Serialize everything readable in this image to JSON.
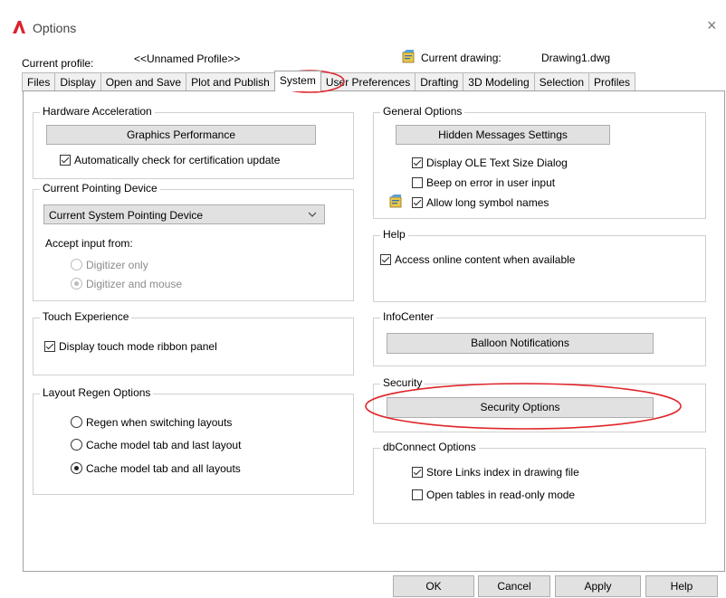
{
  "window": {
    "title": "Options",
    "close_glyph": "×"
  },
  "profile": {
    "current_profile_label": "Current profile:",
    "current_profile_value": "<<Unnamed Profile>>",
    "current_drawing_label": "Current drawing:",
    "current_drawing_value": "Drawing1.dwg"
  },
  "tabs": [
    {
      "label": "Files"
    },
    {
      "label": "Display"
    },
    {
      "label": "Open and Save"
    },
    {
      "label": "Plot and Publish"
    },
    {
      "label": "System",
      "active": true
    },
    {
      "label": "User Preferences"
    },
    {
      "label": "Drafting"
    },
    {
      "label": "3D Modeling"
    },
    {
      "label": "Selection"
    },
    {
      "label": "Profiles"
    }
  ],
  "hardware_acceleration": {
    "title": "Hardware Acceleration",
    "button": "Graphics Performance",
    "auto_check_label": "Automatically check for certification update",
    "auto_check": true
  },
  "pointing_device": {
    "title": "Current Pointing Device",
    "selected": "Current System Pointing Device",
    "accept_input_label": "Accept input from:",
    "options": [
      {
        "label": "Digitizer only",
        "selected": false
      },
      {
        "label": "Digitizer and mouse",
        "selected": true
      }
    ]
  },
  "touch_experience": {
    "title": "Touch Experience",
    "ribbon_label": "Display touch mode ribbon panel",
    "ribbon": true
  },
  "layout_regen": {
    "title": "Layout Regen Options",
    "options": [
      {
        "label": "Regen when switching layouts",
        "selected": false
      },
      {
        "label": "Cache model tab and last layout",
        "selected": false
      },
      {
        "label": "Cache model tab and all layouts",
        "selected": true
      }
    ]
  },
  "general_options": {
    "title": "General Options",
    "button": "Hidden Messages Settings",
    "items": [
      {
        "label": "Display OLE Text Size Dialog",
        "checked": true
      },
      {
        "label": "Beep on error in user input",
        "checked": false
      },
      {
        "label": "Allow long symbol names",
        "checked": true
      }
    ]
  },
  "help": {
    "title": "Help",
    "online_label": "Access online content when available",
    "online": true
  },
  "infocenter": {
    "title": "InfoCenter",
    "button": "Balloon Notifications"
  },
  "security": {
    "title": "Security",
    "button": "Security Options"
  },
  "dbconnect": {
    "title": "dbConnect Options",
    "items": [
      {
        "label": "Store Links index in drawing file",
        "checked": true
      },
      {
        "label": "Open tables in read-only mode",
        "checked": false
      }
    ]
  },
  "buttons": {
    "ok": "OK",
    "cancel": "Cancel",
    "apply": "Apply",
    "help": "Help"
  },
  "colors": {
    "logo_red": "#d9232d",
    "annotation_red": "#e0262b",
    "button_face": "#e1e1e1"
  },
  "icons": {
    "app": "autocad-a-icon",
    "drawing": "drawing-file-icon"
  }
}
